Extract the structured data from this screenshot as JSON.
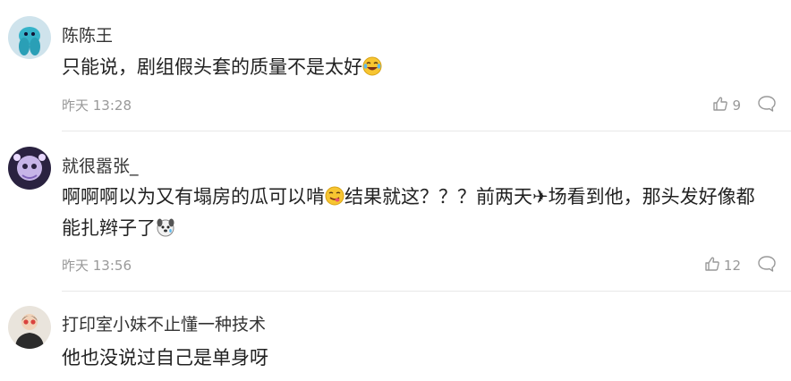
{
  "comments": [
    {
      "username": "陈陈王",
      "text": "只能说，剧组假头套的质量不是太好",
      "emoji_end": "grinning-sweat-emoji",
      "time": "昨天 13:28",
      "likes": "9"
    },
    {
      "username": "就很嚣张_",
      "text_part1": "啊啊啊以为又有塌房的瓜可以啃",
      "emoji_mid": "savoring-food-emoji",
      "text_part2": "结果就这？？？前两天",
      "airplane": "✈",
      "text_part3": "场看到他，那头发好像都能扎辫子了",
      "emoji_end": "pensive-dog-emoji",
      "time": "昨天 13:56",
      "likes": "12"
    },
    {
      "username": "打印室小妹不止懂一种技术",
      "text": "他也没说过自己是单身呀"
    }
  ],
  "colors": {
    "text_primary": "#222222",
    "text_meta": "#999999",
    "divider": "#e8e8e8",
    "background": "#ffffff"
  },
  "icons": [
    "thumbs-up-icon",
    "comment-bubble-icon"
  ]
}
